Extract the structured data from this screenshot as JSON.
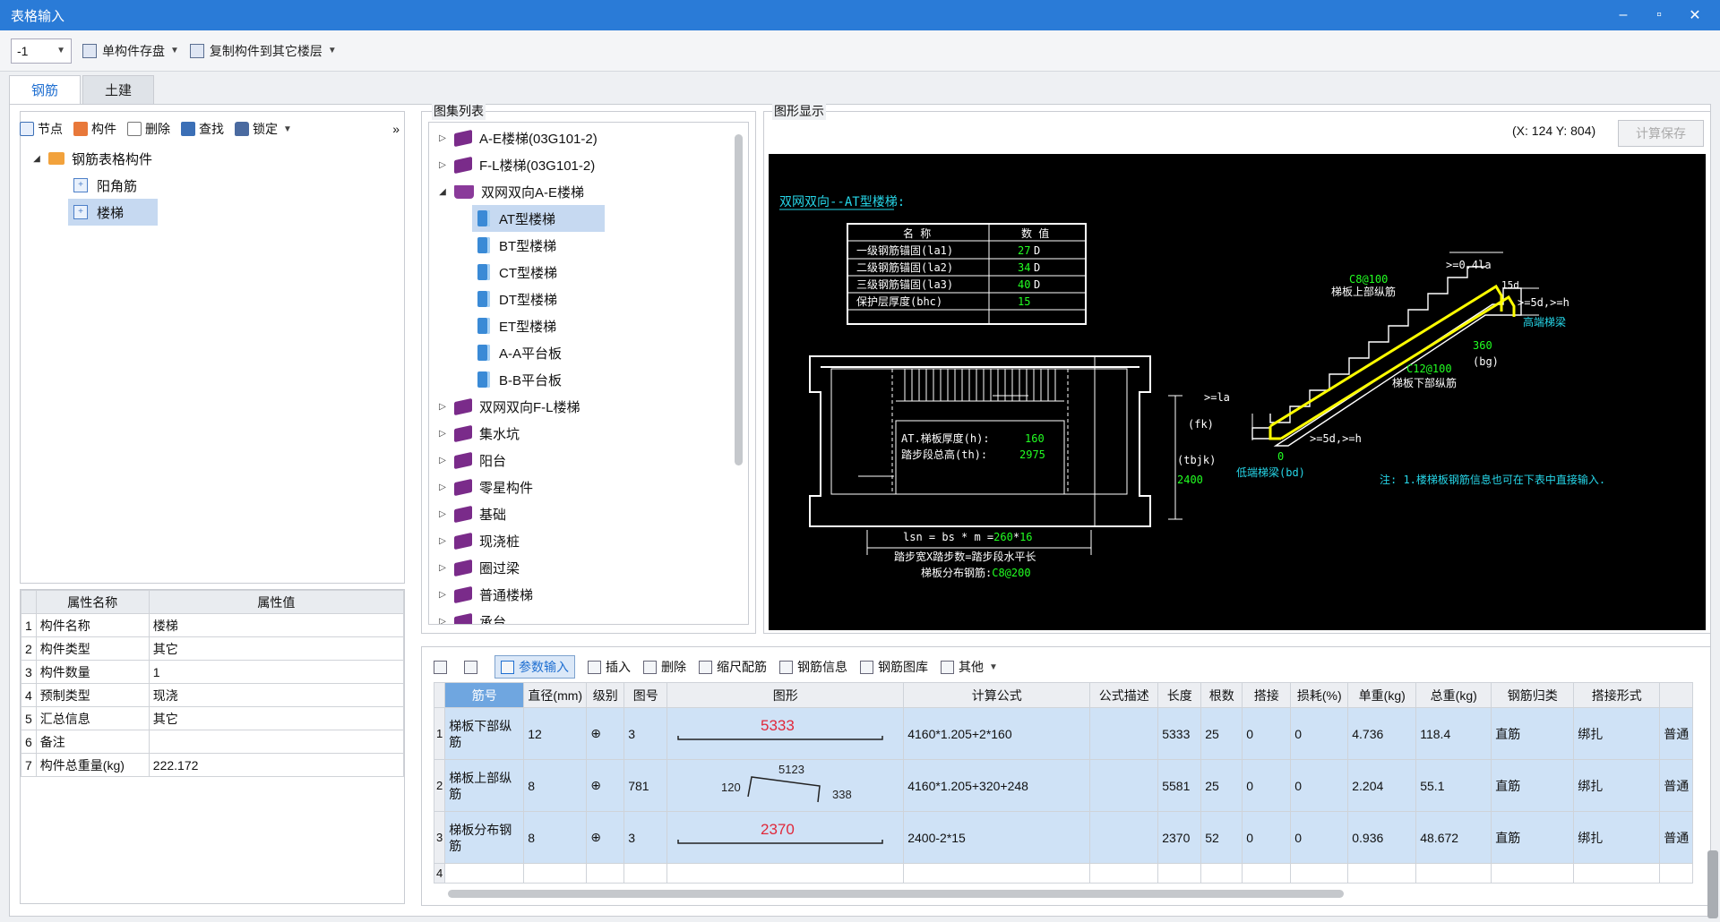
{
  "window": {
    "title": "表格输入",
    "controls": [
      "–",
      "▫",
      "✕"
    ]
  },
  "toolbar": {
    "floor_value": "-1",
    "save_label": "单构件存盘",
    "copy_label": "复制构件到其它楼层"
  },
  "tabs": [
    {
      "label": "钢筋"
    },
    {
      "label": "土建"
    }
  ],
  "left_toolbar": {
    "node": "节点",
    "component": "构件",
    "delete": "删除",
    "find": "查找",
    "lock": "锁定",
    "more": "»"
  },
  "component_tree": {
    "root": "钢筋表格构件",
    "children": [
      "阳角筋",
      "楼梯"
    ]
  },
  "properties": {
    "headers": [
      "属性名称",
      "属性值"
    ],
    "rows": [
      {
        "n": "1",
        "name": "构件名称",
        "value": "楼梯"
      },
      {
        "n": "2",
        "name": "构件类型",
        "value": "其它"
      },
      {
        "n": "3",
        "name": "构件数量",
        "value": "1"
      },
      {
        "n": "4",
        "name": "预制类型",
        "value": "现浇"
      },
      {
        "n": "5",
        "name": "汇总信息",
        "value": "其它"
      },
      {
        "n": "6",
        "name": "备注",
        "value": ""
      },
      {
        "n": "7",
        "name": "构件总重量(kg)",
        "value": "222.172"
      }
    ]
  },
  "atlas": {
    "title": "图集列表",
    "items": [
      {
        "label": "A-E楼梯(03G101-2)",
        "level": 0,
        "type": "book",
        "exp": "▷"
      },
      {
        "label": "F-L楼梯(03G101-2)",
        "level": 0,
        "type": "book",
        "exp": "▷"
      },
      {
        "label": "双网双向A-E楼梯",
        "level": 0,
        "type": "openbook",
        "exp": "◢"
      },
      {
        "label": "AT型楼梯",
        "level": 1,
        "type": "page",
        "exp": ""
      },
      {
        "label": "BT型楼梯",
        "level": 1,
        "type": "page",
        "exp": ""
      },
      {
        "label": "CT型楼梯",
        "level": 1,
        "type": "page",
        "exp": ""
      },
      {
        "label": "DT型楼梯",
        "level": 1,
        "type": "page",
        "exp": ""
      },
      {
        "label": "ET型楼梯",
        "level": 1,
        "type": "page",
        "exp": ""
      },
      {
        "label": "A-A平台板",
        "level": 1,
        "type": "page",
        "exp": ""
      },
      {
        "label": "B-B平台板",
        "level": 1,
        "type": "page",
        "exp": ""
      },
      {
        "label": "双网双向F-L楼梯",
        "level": 0,
        "type": "book",
        "exp": "▷"
      },
      {
        "label": "集水坑",
        "level": 0,
        "type": "book",
        "exp": "▷"
      },
      {
        "label": "阳台",
        "level": 0,
        "type": "book",
        "exp": "▷"
      },
      {
        "label": "零星构件",
        "level": 0,
        "type": "book",
        "exp": "▷"
      },
      {
        "label": "基础",
        "level": 0,
        "type": "book",
        "exp": "▷"
      },
      {
        "label": "现浇桩",
        "level": 0,
        "type": "book",
        "exp": "▷"
      },
      {
        "label": "圈过梁",
        "level": 0,
        "type": "book",
        "exp": "▷"
      },
      {
        "label": "普通楼梯",
        "level": 0,
        "type": "book",
        "exp": "▷"
      },
      {
        "label": "承台",
        "level": 0,
        "type": "book",
        "exp": "▷"
      }
    ]
  },
  "graphic": {
    "title": "图形显示",
    "coords": "(X: 124 Y: 804)",
    "calc_save": "计算保存",
    "cad": {
      "heading": "双网双向--AT型楼梯:",
      "table_headers": [
        "名 称",
        "数 值"
      ],
      "table_rows": [
        {
          "name": "一级钢筋锚固(la1)",
          "val": "27",
          "unit": "D"
        },
        {
          "name": "二级钢筋锚固(la2)",
          "val": "34",
          "unit": "D"
        },
        {
          "name": "三级钢筋锚固(la3)",
          "val": "40",
          "unit": "D"
        },
        {
          "name": "保护层厚度(bhc)",
          "val": "15",
          "unit": ""
        }
      ],
      "thick_label": "AT.梯板厚度(h):",
      "thick_val": "160",
      "height_label": "踏步段总高(th):",
      "height_val": "2975",
      "fk": "(fk)",
      "tbjk": "(tbjk)",
      "tbjk_val": "2400",
      "lsn_pre": "lsn = bs * m =",
      "lsn_bs": "260",
      "lsn_star": "*",
      "lsn_m": "16",
      "lsn_note": "踏步宽X踏步数=踏步段水平长",
      "dist_label": "梯板分布钢筋:",
      "dist_val": "C8@200",
      "top_bar": "C8@100",
      "top_label": "梯板上部纵筋",
      "bot_bar": "C12@100",
      "bot_label": "梯板下部纵筋",
      "ann_04la": ">=0.4la",
      "ann_15d": "15d",
      "ann_5d_h": ">=5d,>=h",
      "high_beam": "高端梯梁",
      "bg_val": "360",
      "bg": "(bg)",
      "ann_la": ">=la",
      "zero": "0",
      "ann_5d_h2": ">=5d,>=h",
      "low_beam": "低端梯梁(bd)",
      "note": "注: 1.楼梯板钢筋信息也可在下表中直接输入."
    }
  },
  "grid_toolbar": {
    "param_input": "参数输入",
    "insert": "插入",
    "delete": "删除",
    "scale": "缩尺配筋",
    "info": "钢筋信息",
    "library": "钢筋图库",
    "other": "其他"
  },
  "grid": {
    "headers": [
      "筋号",
      "直径(mm)",
      "级别",
      "图号",
      "图形",
      "计算公式",
      "公式描述",
      "长度",
      "根数",
      "搭接",
      "损耗(%)",
      "单重(kg)",
      "总重(kg)",
      "钢筋归类",
      "搭接形式",
      ""
    ],
    "rows": [
      {
        "n": "1",
        "name": "梯板下部纵筋",
        "dia": "12",
        "grade": "⊕",
        "fig": "3",
        "shape_val": "5333",
        "formula": "4160*1.205+2*160",
        "desc": "",
        "len": "5333",
        "count": "25",
        "lap": "0",
        "loss": "0",
        "unit_w": "4.736",
        "total_w": "118.4",
        "cat": "直筋",
        "lap_type": "绑扎",
        "extra": "普通"
      },
      {
        "n": "2",
        "name": "梯板上部纵筋",
        "dia": "8",
        "grade": "⊕",
        "fig": "781",
        "shape_left": "120",
        "shape_mid": "5123",
        "shape_right": "338",
        "formula": "4160*1.205+320+248",
        "desc": "",
        "len": "5581",
        "count": "25",
        "lap": "0",
        "loss": "0",
        "unit_w": "2.204",
        "total_w": "55.1",
        "cat": "直筋",
        "lap_type": "绑扎",
        "extra": "普通"
      },
      {
        "n": "3",
        "name": "梯板分布钢筋",
        "dia": "8",
        "grade": "⊕",
        "fig": "3",
        "shape_val": "2370",
        "formula": "2400-2*15",
        "desc": "",
        "len": "2370",
        "count": "52",
        "lap": "0",
        "loss": "0",
        "unit_w": "0.936",
        "total_w": "48.672",
        "cat": "直筋",
        "lap_type": "绑扎",
        "extra": "普通"
      }
    ],
    "empty_row_n": "4"
  },
  "colors": {
    "titlebar": "#2a7bd7",
    "cad_bg": "#000000",
    "cad_green": "#22ff22",
    "cad_cyan": "#26d6e8",
    "cad_yellow": "#ffff00",
    "selection": "#c6d9f1",
    "shape_red": "#e0283a"
  }
}
